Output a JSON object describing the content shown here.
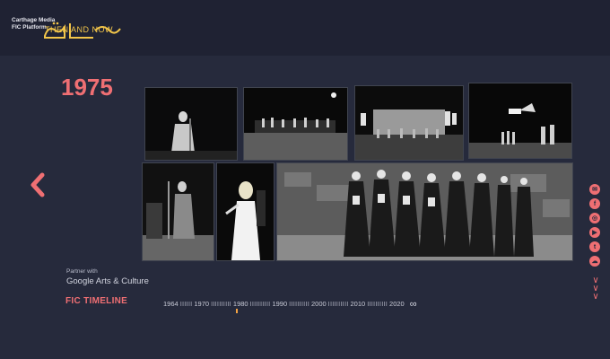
{
  "header": {
    "brand_text": "Carthage Media FIC Platform",
    "logo_latin": "THEN AND NOW"
  },
  "main": {
    "year": "1975",
    "prev_icon": "chevron-left-icon",
    "photos": [
      {
        "name": "photo-singer-stage"
      },
      {
        "name": "photo-orchestra-stage"
      },
      {
        "name": "photo-theater-stage"
      },
      {
        "name": "photo-flag-performance"
      },
      {
        "name": "photo-guitarist-mic"
      },
      {
        "name": "photo-female-singer"
      },
      {
        "name": "photo-folk-dancers"
      }
    ]
  },
  "partner": {
    "line1": "Partner with",
    "line2": "Google Arts & Culture"
  },
  "timeline": {
    "title": "FIC TIMELINE",
    "labels": [
      "1964",
      "1970",
      "1980",
      "1990",
      "2000",
      "2010",
      "2020"
    ],
    "end_symbol": "∞"
  },
  "social": {
    "icons": [
      "email-icon",
      "facebook-icon",
      "instagram-icon",
      "youtube-icon",
      "twitter-icon",
      "soundcloud-icon"
    ],
    "down_icon": "chevron-down-icon"
  },
  "colors": {
    "accent": "#ef6f73",
    "background": "#262a3c",
    "logo": "#f3c64a"
  }
}
